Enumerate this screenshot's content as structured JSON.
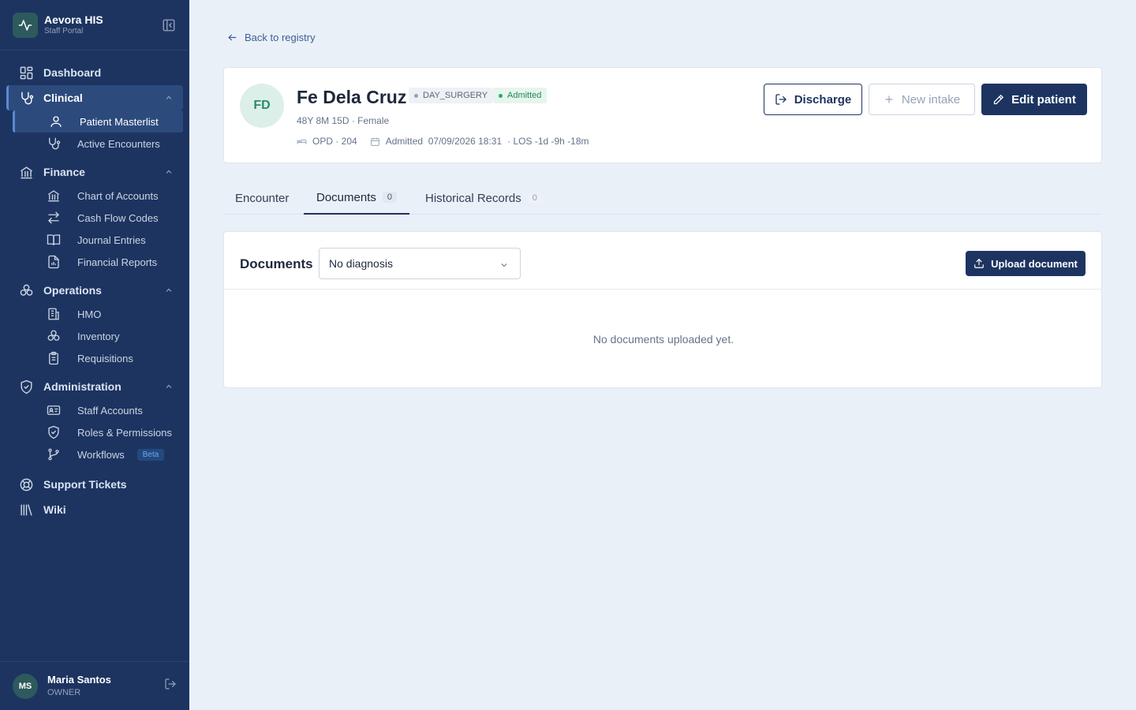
{
  "app": {
    "name": "Aevora HIS",
    "subtitle": "Staff Portal"
  },
  "nav": {
    "dashboard": "Dashboard",
    "clinical": {
      "label": "Clinical",
      "items": [
        "Patient Masterlist",
        "Active Encounters"
      ]
    },
    "finance": {
      "label": "Finance",
      "items": [
        "Chart of Accounts",
        "Cash Flow Codes",
        "Journal Entries",
        "Financial Reports"
      ]
    },
    "operations": {
      "label": "Operations",
      "items": [
        "HMO",
        "Inventory",
        "Requisitions"
      ]
    },
    "administration": {
      "label": "Administration",
      "items": [
        "Staff Accounts",
        "Roles & Permissions",
        "Workflows"
      ],
      "beta_badge": "Beta"
    },
    "support": "Support Tickets",
    "wiki": "Wiki"
  },
  "user": {
    "initials": "MS",
    "name": "Maria Santos",
    "role": "OWNER"
  },
  "back_link": "Back to registry",
  "patient": {
    "initials": "FD",
    "name": "Fe Dela Cruz",
    "type_tag": "DAY_SURGERY",
    "status_tag": "Admitted",
    "demographics": "48Y 8M 15D · Female",
    "location": "OPD · 204",
    "admitted": "Admitted  07/09/2026 18:31",
    "los": "· LOS -1d -9h -18m"
  },
  "actions": {
    "discharge": "Discharge",
    "new_intake": "New intake",
    "edit_patient": "Edit patient"
  },
  "tabs": [
    {
      "label": "Encounter"
    },
    {
      "label": "Documents",
      "count": "0"
    },
    {
      "label": "Historical Records",
      "count": "0"
    }
  ],
  "documents": {
    "title": "Documents",
    "filter_value": "No diagnosis",
    "upload_label": "Upload document",
    "empty_message": "No documents uploaded yet."
  },
  "colors": {
    "sidebar": "#1d3461",
    "accent": "#1d3461",
    "background": "#eaf0f8",
    "admitted": "#23875e"
  }
}
